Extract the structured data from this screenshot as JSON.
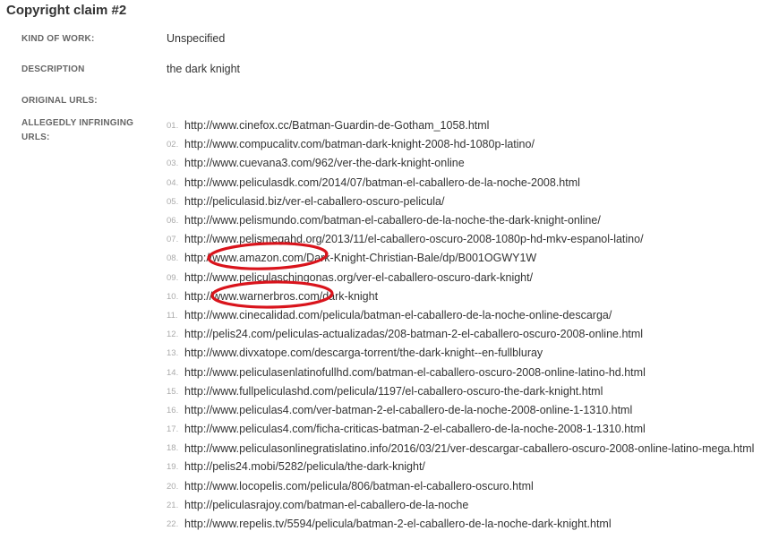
{
  "claim": {
    "title": "Copyright claim #2"
  },
  "fields": {
    "kind_of_work_label": "KIND OF WORK:",
    "kind_of_work_value": "Unspecified",
    "description_label": "DESCRIPTION",
    "description_value": "the dark knight",
    "original_urls_label": "ORIGINAL URLS:",
    "infringing_label_line1": "ALLEGEDLY INFRINGING",
    "infringing_label_line2": "URLS:"
  },
  "urls": [
    {
      "num": "01.",
      "url": "http://www.cinefox.cc/Batman-Guardin-de-Gotham_1058.html"
    },
    {
      "num": "02.",
      "url": "http://www.compucalitv.com/batman-dark-knight-2008-hd-1080p-latino/"
    },
    {
      "num": "03.",
      "url": "http://www.cuevana3.com/962/ver-the-dark-knight-online"
    },
    {
      "num": "04.",
      "url": "http://www.peliculasdk.com/2014/07/batman-el-caballero-de-la-noche-2008.html"
    },
    {
      "num": "05.",
      "url": "http://peliculasid.biz/ver-el-caballero-oscuro-pelicula/"
    },
    {
      "num": "06.",
      "url": "http://www.pelismundo.com/batman-el-caballero-de-la-noche-the-dark-knight-online/"
    },
    {
      "num": "07.",
      "url": "http://www.pelismegahd.org/2013/11/el-caballero-oscuro-2008-1080p-hd-mkv-espanol-latino/"
    },
    {
      "num": "08.",
      "url": "http://www.amazon.com/Dark-Knight-Christian-Bale/dp/B001OGWY1W"
    },
    {
      "num": "09.",
      "url": "http://www.peliculaschingonas.org/ver-el-caballero-oscuro-dark-knight/"
    },
    {
      "num": "10.",
      "url": "http://www.warnerbros.com/dark-knight"
    },
    {
      "num": "11.",
      "url": "http://www.cinecalidad.com/pelicula/batman-el-caballero-de-la-noche-online-descarga/"
    },
    {
      "num": "12.",
      "url": "http://pelis24.com/peliculas-actualizadas/208-batman-2-el-caballero-oscuro-2008-online.html"
    },
    {
      "num": "13.",
      "url": "http://www.divxatope.com/descarga-torrent/the-dark-knight--en-fullbluray"
    },
    {
      "num": "14.",
      "url": "http://www.peliculasenlatinofullhd.com/batman-el-caballero-oscuro-2008-online-latino-hd.html"
    },
    {
      "num": "15.",
      "url": "http://www.fullpeliculashd.com/pelicula/1197/el-caballero-oscuro-the-dark-knight.html"
    },
    {
      "num": "16.",
      "url": "http://www.peliculas4.com/ver-batman-2-el-caballero-de-la-noche-2008-online-1-1310.html"
    },
    {
      "num": "17.",
      "url": "http://www.peliculas4.com/ficha-criticas-batman-2-el-caballero-de-la-noche-2008-1-1310.html"
    },
    {
      "num": "18.",
      "url": "http://www.peliculasonlinegratislatino.info/2016/03/21/ver-descargar-caballero-oscuro-2008-online-latino-mega.html"
    },
    {
      "num": "19.",
      "url": "http://pelis24.mobi/5282/pelicula/the-dark-knight/"
    },
    {
      "num": "20.",
      "url": "http://www.locopelis.com/pelicula/806/batman-el-caballero-oscuro.html"
    },
    {
      "num": "21.",
      "url": "http://peliculasrajoy.com/batman-el-caballero-de-la-noche"
    },
    {
      "num": "22.",
      "url": "http://www.repelis.tv/5594/pelicula/batman-2-el-caballero-de-la-noche-dark-knight.html"
    }
  ],
  "annotation": {
    "circle_color": "#d9141c",
    "circled_items": [
      "08.",
      "10."
    ]
  }
}
